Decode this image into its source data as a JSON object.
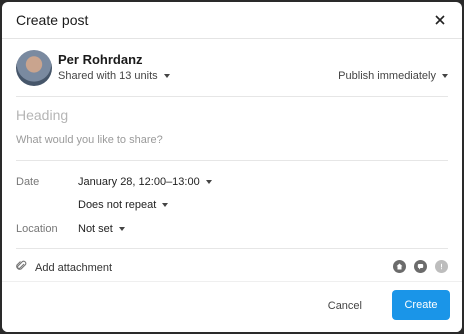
{
  "dialog": {
    "title": "Create post"
  },
  "author": {
    "name": "Per Rohrdanz",
    "shared_with": "Shared with 13 units",
    "publish": "Publish immediately"
  },
  "compose": {
    "heading_placeholder": "Heading",
    "body_placeholder": "What would you like to share?"
  },
  "fields": {
    "date_label": "Date",
    "date_value": "January 28, 12:00–13:00",
    "repeat_value": "Does not repeat",
    "location_label": "Location",
    "location_value": "Not set"
  },
  "attachment": {
    "label": "Add attachment"
  },
  "toolbar_icons": [
    "home-icon",
    "chat-icon",
    "alert-icon"
  ],
  "footer": {
    "cancel_label": "Cancel",
    "create_label": "Create"
  },
  "colors": {
    "accent": "#1a95e8"
  }
}
